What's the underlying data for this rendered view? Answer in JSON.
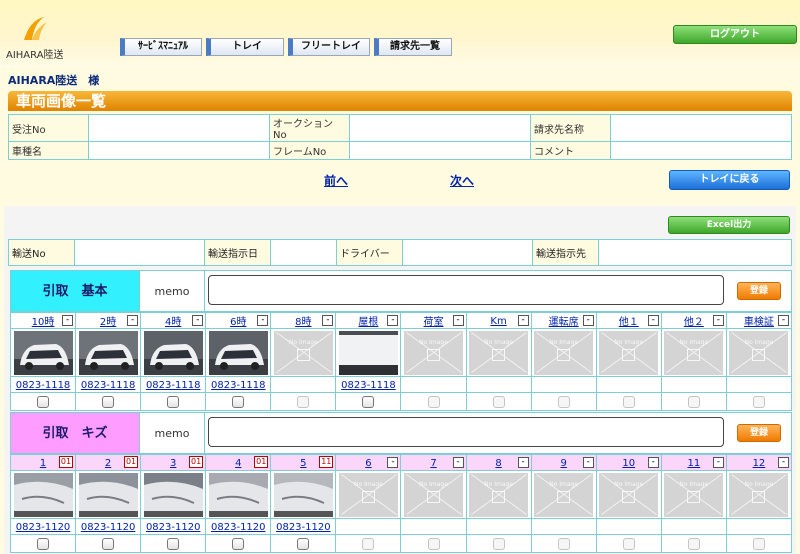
{
  "brand": {
    "name": "AIHARA陸送"
  },
  "nav": [
    "ｻｰﾋﾞｽﾏﾆｭｱﾙ",
    "トレイ",
    "フリートレイ",
    "請求先一覧"
  ],
  "logout_label": "ログアウト",
  "user_label": "AIHARA陸送　様",
  "page_title": "車両画像一覧",
  "info": {
    "row1": [
      "受注No",
      "オークションNo",
      "請求先名称"
    ],
    "row2": [
      "車種名",
      "フレームNo",
      "コメント"
    ]
  },
  "pager": {
    "prev": "前へ",
    "next": "次へ"
  },
  "back_tray_label": "トレイに戻る",
  "excel_label": "Excel出力",
  "ship": [
    "輸送No",
    "輸送指示日",
    "ドライバー",
    "輸送指示先"
  ],
  "no_image_text": "No Image",
  "minus_symbol": "-",
  "sections": [
    {
      "label": "引取　基本",
      "color": "#33f0ff",
      "memo_label": "memo",
      "register_label": "登録",
      "columns": [
        {
          "label": "10時",
          "photo": "car-white-front",
          "code": "0823-1118"
        },
        {
          "label": "2時",
          "photo": "car-white-front",
          "code": "0823-1118"
        },
        {
          "label": "4時",
          "photo": "car-white-rear",
          "code": "0823-1118"
        },
        {
          "label": "6時",
          "photo": "car-white-rear",
          "code": "0823-1118"
        },
        {
          "label": "8時",
          "photo": "",
          "code": ""
        },
        {
          "label": "屋根",
          "photo": "roof",
          "code": "0823-1118"
        },
        {
          "label": "荷室",
          "photo": "",
          "code": ""
        },
        {
          "label": "Km",
          "photo": "",
          "code": ""
        },
        {
          "label": "運転席",
          "photo": "",
          "code": ""
        },
        {
          "label": "他１",
          "photo": "",
          "code": ""
        },
        {
          "label": "他２",
          "photo": "",
          "code": ""
        },
        {
          "label": "車検証",
          "photo": "",
          "code": ""
        }
      ]
    },
    {
      "label": "引取　キズ",
      "color": "#ff9cff",
      "memo_label": "memo",
      "register_label": "登録",
      "columns": [
        {
          "label": "1",
          "count": "01",
          "photo": "damage-side",
          "code": "0823-1120"
        },
        {
          "label": "2",
          "count": "01",
          "photo": "damage-bumper",
          "code": "0823-1120"
        },
        {
          "label": "3",
          "count": "01",
          "photo": "damage-rear",
          "code": "0823-1120"
        },
        {
          "label": "4",
          "count": "01",
          "photo": "damage-light",
          "code": "0823-1120"
        },
        {
          "label": "5",
          "count": "11",
          "photo": "damage-panel",
          "code": "0823-1120"
        },
        {
          "label": "6",
          "count": "",
          "photo": "",
          "code": ""
        },
        {
          "label": "7",
          "count": "",
          "photo": "",
          "code": ""
        },
        {
          "label": "8",
          "count": "",
          "photo": "",
          "code": ""
        },
        {
          "label": "9",
          "count": "",
          "photo": "",
          "code": ""
        },
        {
          "label": "10",
          "count": "",
          "photo": "",
          "code": ""
        },
        {
          "label": "11",
          "count": "",
          "photo": "",
          "code": ""
        },
        {
          "label": "12",
          "count": "",
          "photo": "",
          "code": ""
        }
      ]
    }
  ]
}
